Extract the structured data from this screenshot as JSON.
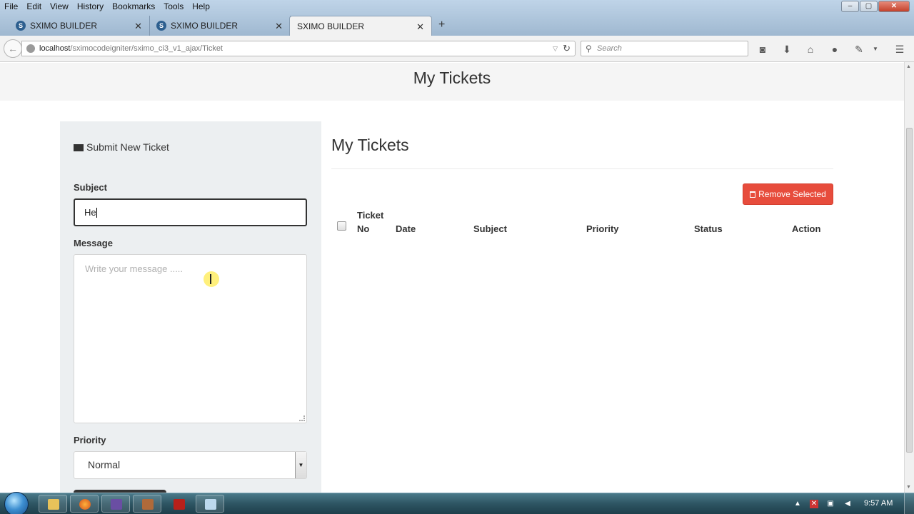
{
  "browser": {
    "menu": [
      "File",
      "Edit",
      "View",
      "History",
      "Bookmarks",
      "Tools",
      "Help"
    ],
    "window_controls": {
      "minimize": "–",
      "maximize": "▢",
      "close": "✕"
    },
    "tabs": [
      {
        "title": "SXIMO BUILDER",
        "active": false
      },
      {
        "title": "SXIMO BUILDER",
        "active": false
      },
      {
        "title": "SXIMO BUILDER",
        "active": true
      }
    ],
    "new_tab": "+",
    "url_host": "localhost",
    "url_path": "/sximocodeigniter/sximo_ci3_v1_ajax/Ticket",
    "search_placeholder": "Search",
    "toolbar_icons": [
      "pocket-icon",
      "download-icon",
      "home-icon",
      "chat-icon",
      "extension-icon",
      "menu-icon"
    ]
  },
  "page": {
    "header_title": "My Tickets",
    "form": {
      "title": "Submit New Ticket",
      "subject_label": "Subject",
      "subject_value": "He",
      "message_label": "Message",
      "message_placeholder": "Write your message .....",
      "priority_label": "Priority",
      "priority_value": "Normal"
    },
    "list": {
      "title": "My Tickets",
      "remove_button": "Remove Selected",
      "columns": [
        {
          "line1": "Ticket",
          "line2": "No"
        },
        {
          "line1": "",
          "line2": "Date"
        },
        {
          "line1": "",
          "line2": "Subject"
        },
        {
          "line1": "",
          "line2": "Priority"
        },
        {
          "line1": "",
          "line2": "Status"
        },
        {
          "line1": "",
          "line2": "Action"
        }
      ]
    }
  },
  "taskbar": {
    "apps": [
      "explorer",
      "firefox",
      "visual-studio",
      "app-4",
      "filezilla",
      "notepad"
    ],
    "clock": "9:57 AM"
  },
  "colors": {
    "danger": "#e74c3c",
    "dark": "#333333",
    "panel_bg": "#eceff1"
  }
}
